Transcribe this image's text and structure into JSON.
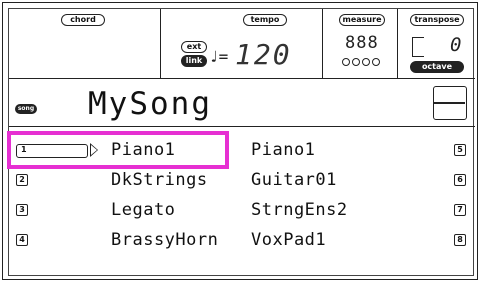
{
  "header": {
    "chord_label": "chord",
    "tempo_label": "tempo",
    "ext_label": "ext",
    "link_label": "link",
    "tempo_value": "120",
    "note_symbol": "♩=",
    "measure_label": "measure",
    "measure_digits": "888",
    "transpose_label": "transpose",
    "transpose_value": "0",
    "octave_label": "octave"
  },
  "song": {
    "badge": "song",
    "name": "MySong"
  },
  "tracks": [
    {
      "num": "1",
      "name": "Piano1"
    },
    {
      "num": "2",
      "name": "DkStrings"
    },
    {
      "num": "3",
      "name": "Legato"
    },
    {
      "num": "4",
      "name": "BrassyHorn"
    }
  ],
  "tracks_right": [
    {
      "num": "5",
      "name": "Piano1"
    },
    {
      "num": "6",
      "name": "Guitar01"
    },
    {
      "num": "7",
      "name": "StrngEns2"
    },
    {
      "num": "8",
      "name": "VoxPad1"
    }
  ],
  "colors": {
    "highlight": "#e62fd2"
  }
}
